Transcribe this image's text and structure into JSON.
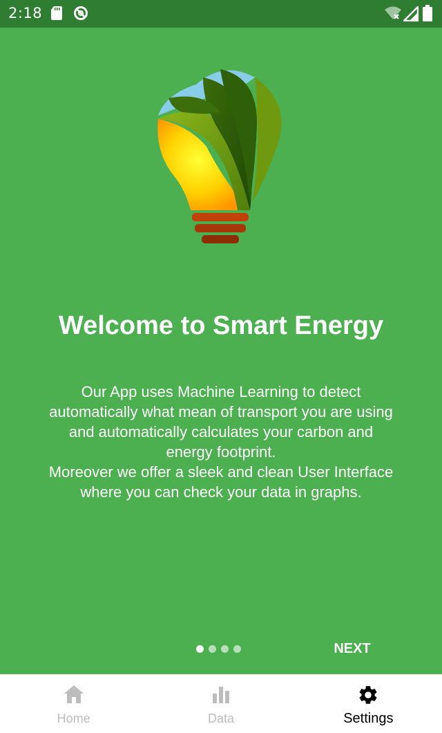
{
  "status_bar": {
    "time": "2:18",
    "icons": [
      "sd-card-icon",
      "do-not-disturb-icon",
      "wifi-off-icon",
      "signal-icon",
      "battery-icon"
    ]
  },
  "onboarding": {
    "title": "Welcome to Smart Energy",
    "description": "Our App uses Machine Learning to detect automatically what mean of transport you are using and automatically calculates your carbon and energy footprint.\nMoreover we offer a sleek and clean User Interface where you can check your data in graphs.",
    "next_label": "NEXT",
    "page_count": 4,
    "current_page": 1
  },
  "bottom_nav": {
    "items": [
      {
        "label": "Home",
        "icon": "home-icon",
        "active": false
      },
      {
        "label": "Data",
        "icon": "bar-chart-icon",
        "active": false
      },
      {
        "label": "Settings",
        "icon": "gear-icon",
        "active": true
      }
    ]
  },
  "colors": {
    "background": "#4caf50",
    "status_bar": "#2e7d32",
    "nav_background": "#ffffff",
    "nav_inactive": "#bdbdbd",
    "nav_active": "#000000"
  }
}
